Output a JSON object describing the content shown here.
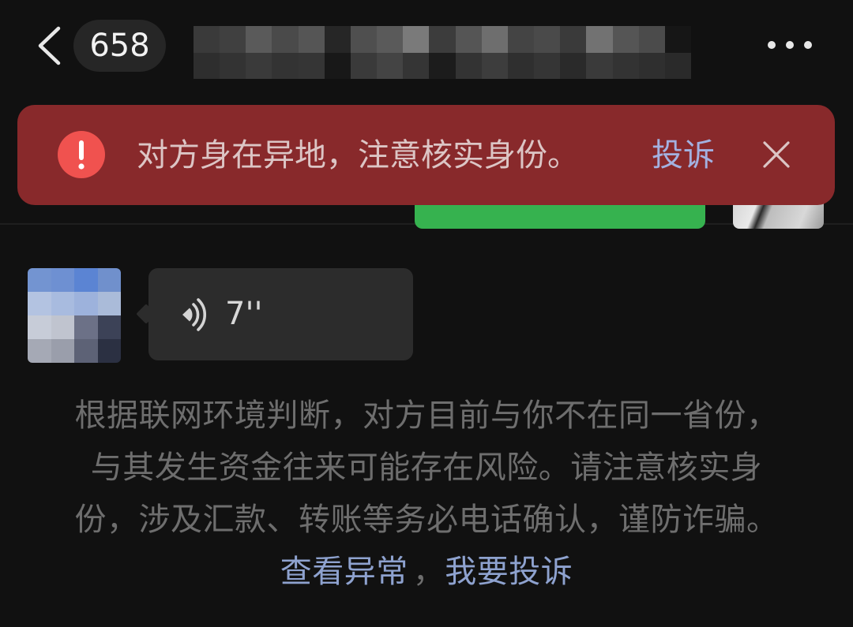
{
  "theme": {
    "background": "#111111"
  },
  "nav": {
    "back_icon": "chevron-left-icon",
    "unread_count": "658",
    "more_icon": "more-icon"
  },
  "security_banner": {
    "alert_icon": "alert-icon",
    "message": "对方身在异地，注意核实身份。",
    "action_label": "投诉",
    "close_icon": "close-icon",
    "background_color": "#88292b",
    "alert_color": "#f0524f",
    "text_color": "#dcc5c5",
    "action_color": "#a3b1e0"
  },
  "chat": {
    "sent_bubble_color": "#36b24f",
    "voice_message": {
      "icon": "voice-icon",
      "duration": "7''",
      "bubble_color": "#2c2c2c"
    }
  },
  "risk_notice": {
    "lines": [
      "根据联网环境判断，对方目前与你不在同一省份，",
      "与其发生资金往来可能存在风险。请注意核实身",
      "份，涉及汇款、转账等务必电话确认，谨防诈骗。"
    ],
    "link_view_anomaly": "查看异常",
    "link_separator": "，",
    "link_report": "我要投诉",
    "text_color": "#6e6e6e",
    "link_color": "#8ea2cf"
  }
}
